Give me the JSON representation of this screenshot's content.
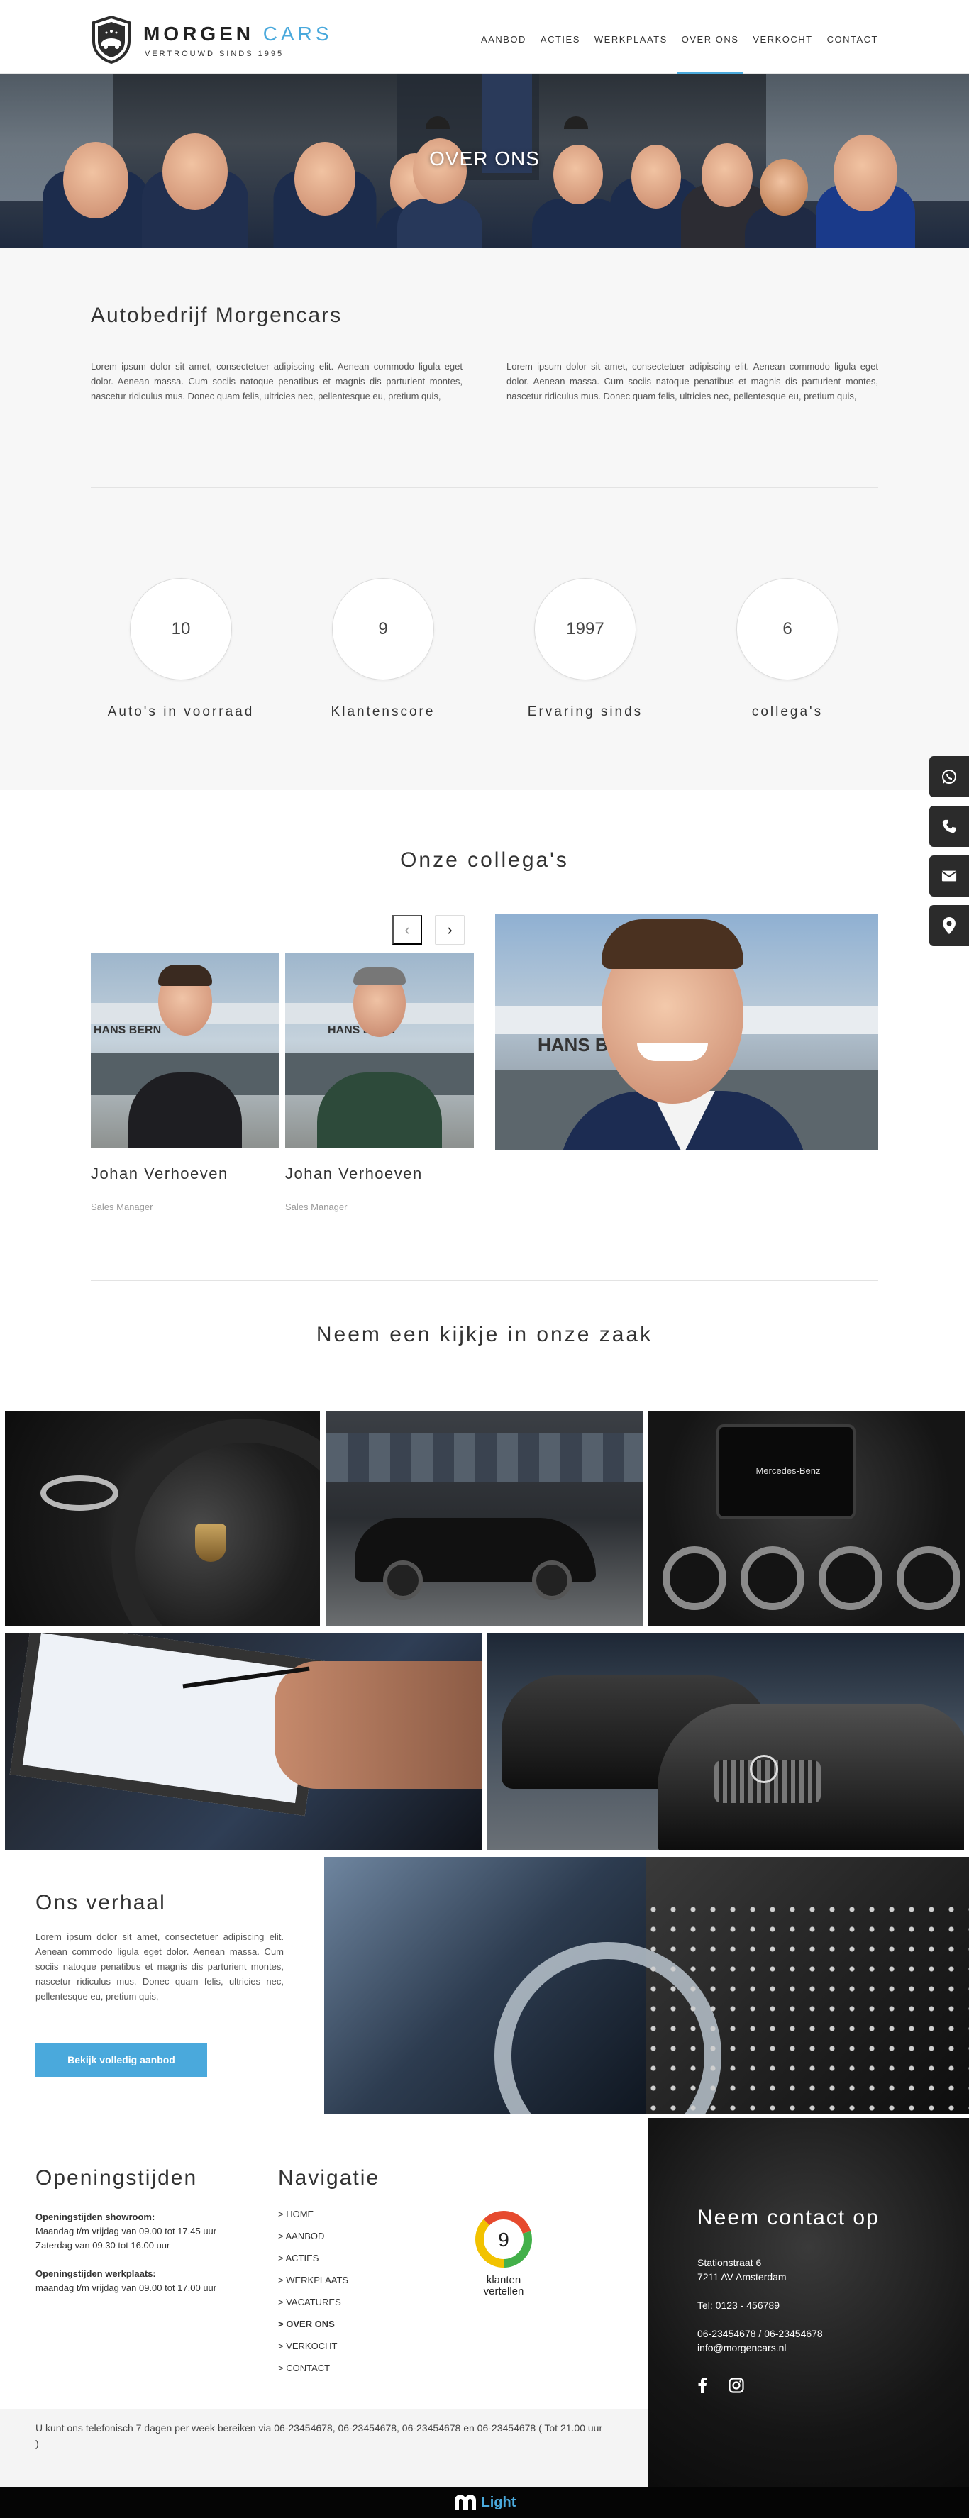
{
  "header": {
    "logo_word1": "MORGEN",
    "logo_word2": "CARS",
    "logo_tagline": "VERTROUWD SINDS 1995",
    "nav": [
      "AANBOD",
      "ACTIES",
      "WERKPLAATS",
      "OVER ONS",
      "VERKOCHT",
      "CONTACT"
    ],
    "active_nav": "OVER ONS"
  },
  "hero": {
    "title": "OVER ONS"
  },
  "about": {
    "title": "Autobedrijf Morgencars",
    "col1": "Lorem ipsum dolor sit amet, consectetuer adipiscing elit. Aenean commodo ligula eget dolor. Aenean massa. Cum sociis natoque penatibus et magnis dis parturient montes, nascetur ridiculus mus. Donec quam felis, ultricies nec, pellentesque eu, pretium quis,",
    "col2": "Lorem ipsum dolor sit amet, consectetuer adipiscing elit. Aenean commodo ligula eget dolor. Aenean massa. Cum sociis natoque penatibus et magnis dis parturient montes, nascetur ridiculus mus. Donec quam felis, ultricies nec, pellentesque eu, pretium quis,",
    "stats": [
      {
        "value": "10",
        "label": "Auto's in voorraad"
      },
      {
        "value": "9",
        "label": "Klantenscore"
      },
      {
        "value": "1997",
        "label": "Ervaring sinds"
      },
      {
        "value": "6",
        "label": "collega's"
      }
    ]
  },
  "side_contact": [
    "whatsapp-icon",
    "phone-icon",
    "mail-icon",
    "location-icon"
  ],
  "team": {
    "title": "Onze collega's",
    "prev_arrow": "‹",
    "next_arrow": "›",
    "members": [
      {
        "name": "Johan Verhoeven",
        "role": "Sales Manager",
        "sign": "HANS BERN"
      },
      {
        "name": "Johan Verhoeven",
        "role": "Sales Manager",
        "sign": "HANS BERN"
      }
    ],
    "big_sign": "HANS BE"
  },
  "gallery": {
    "title": "Neem een kijkje in onze zaak",
    "brand_display": "Mercedes-Benz"
  },
  "story": {
    "title": "Ons verhaal",
    "text": "Lorem ipsum dolor sit amet, consectetuer adipiscing elit. Aenean commodo ligula eget dolor. Aenean massa. Cum sociis natoque penatibus et magnis dis parturient montes, nascetur ridiculus mus. Donec quam felis, ultricies nec, pellentesque eu, pretium quis,",
    "button": "Bekijk volledig aanbod"
  },
  "footer": {
    "hours_title": "Openingstijden",
    "showroom_label": "Openingstijden showroom:",
    "showroom_lines": [
      "Maandag t/m vrijdag van 09.00 tot 17.45 uur",
      "Zaterdag van 09.30 tot 16.00 uur"
    ],
    "workshop_label": "Openingstijden werkplaats:",
    "workshop_lines": [
      "maandag t/m vrijdag van 09.00 tot 17.00 uur"
    ],
    "nav_title": "Navigatie",
    "nav_links": [
      "> HOME",
      "> AANBOD",
      "> ACTIES",
      "> WERKPLAATS",
      "> VACATURES",
      "> OVER ONS",
      "> VERKOCHT",
      "> CONTACT"
    ],
    "active_link": "> OVER ONS",
    "klanten_score": "9",
    "klanten_line1": "klanten",
    "klanten_line2": "vertellen",
    "contact_title": "Neem contact op",
    "address": [
      "Stationstraat 6",
      "7211 AV Amsterdam"
    ],
    "tel": "Tel: 0123 - 456789",
    "phones": "06-23454678 / 06-23454678",
    "email": "info@morgencars.nl",
    "bottom_text": "U kunt ons telefonisch 7 dagen per week bereiken via 06-23454678, 06-23454678, 06-23454678 en 06-23454678 ( Tot 21.00 uur )",
    "brand_badge": "Light"
  }
}
